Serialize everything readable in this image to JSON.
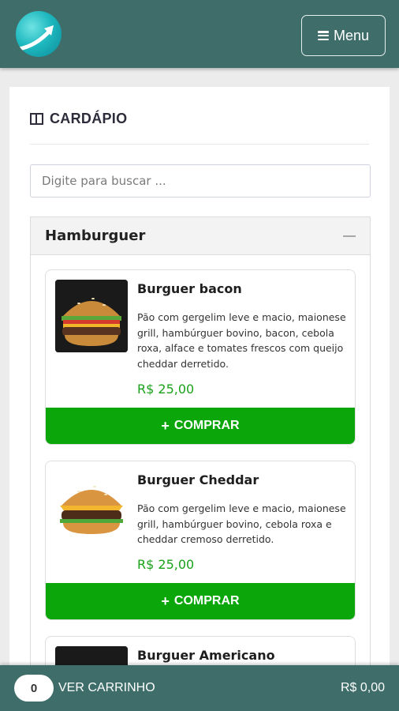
{
  "header": {
    "menu_label": "Menu"
  },
  "icons": {
    "logo": "logo-icon",
    "menu": "menu-icon",
    "book": "book-icon",
    "collapse": "minus-icon",
    "plus": "plus-icon"
  },
  "colors": {
    "header_bg": "#3f6e6a",
    "buy_button": "#0aa60a",
    "price": "#1aa21a"
  },
  "page": {
    "title": "CARDÁPIO"
  },
  "search": {
    "placeholder": "Digite para buscar ..."
  },
  "category": {
    "name": "Hamburguer",
    "items": [
      {
        "name": "Burguer bacon",
        "description": "Pão com gergelim leve e macio, maionese grill, hambúrguer bovino, bacon, cebola roxa, alface e tomates frescos com queijo cheddar derretido.",
        "price": "R$ 25,00",
        "buy_label": "COMPRAR"
      },
      {
        "name": "Burguer Cheddar",
        "description": "Pão com gergelim leve e macio, maionese grill, hambúrguer bovino, cebola roxa e cheddar cremoso derretido.",
        "price": "R$ 25,00",
        "buy_label": "COMPRAR"
      },
      {
        "name": "Burguer Americano"
      }
    ]
  },
  "cart": {
    "count": "0",
    "label": "VER CARRINHO",
    "total": "R$ 0,00"
  }
}
